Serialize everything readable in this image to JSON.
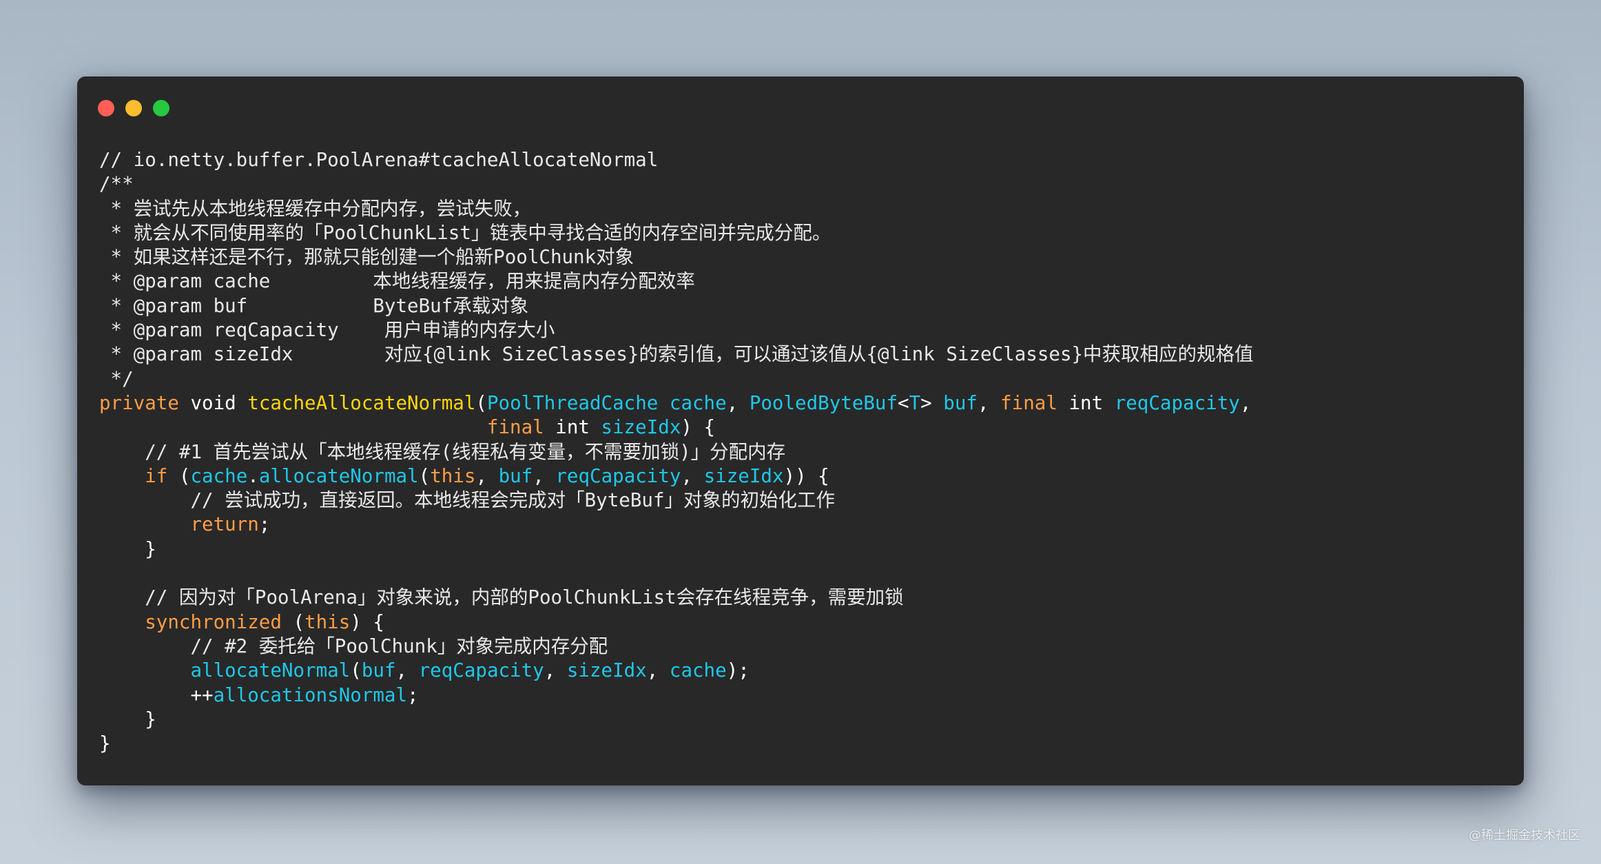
{
  "window": {
    "background": "#282828",
    "buttons": [
      {
        "name": "close",
        "color": "#ff5f57"
      },
      {
        "name": "minimize",
        "color": "#febc2e"
      },
      {
        "name": "maximize",
        "color": "#28c840"
      }
    ]
  },
  "syntax_colors": {
    "comment": "#e8e8e8",
    "keyword": "#ff9d45",
    "type": "#ffffff",
    "method": "#ffd60a",
    "identifier": "#1fc7e8",
    "plain": "#ffffff"
  },
  "code_lines": [
    [
      {
        "t": "// io.netty.buffer.PoolArena#tcacheAllocateNormal",
        "c": "comment"
      }
    ],
    [
      {
        "t": "/**",
        "c": "comment"
      }
    ],
    [
      {
        "t": " * 尝试先从本地线程缓存中分配内存，尝试失败，",
        "c": "comment"
      }
    ],
    [
      {
        "t": " * 就会从不同使用率的「PoolChunkList」链表中寻找合适的内存空间并完成分配。",
        "c": "comment"
      }
    ],
    [
      {
        "t": " * 如果这样还是不行，那就只能创建一个船新PoolChunk对象",
        "c": "comment"
      }
    ],
    [
      {
        "t": " * @param cache         本地线程缓存，用来提高内存分配效率",
        "c": "comment"
      }
    ],
    [
      {
        "t": " * @param buf           ByteBuf承载对象",
        "c": "comment"
      }
    ],
    [
      {
        "t": " * @param reqCapacity    用户申请的内存大小",
        "c": "comment"
      }
    ],
    [
      {
        "t": " * @param sizeIdx        对应{@link SizeClasses}的索引值，可以通过该值从{@link SizeClasses}中获取相应的规格值",
        "c": "comment"
      }
    ],
    [
      {
        "t": " */",
        "c": "comment"
      }
    ],
    [
      {
        "t": "private",
        "c": "keyword"
      },
      {
        "t": " ",
        "c": "plain"
      },
      {
        "t": "void",
        "c": "type"
      },
      {
        "t": " ",
        "c": "plain"
      },
      {
        "t": "tcacheAllocateNormal",
        "c": "method"
      },
      {
        "t": "(",
        "c": "plain"
      },
      {
        "t": "PoolThreadCache",
        "c": "identifier"
      },
      {
        "t": " ",
        "c": "plain"
      },
      {
        "t": "cache",
        "c": "identifier"
      },
      {
        "t": ", ",
        "c": "plain"
      },
      {
        "t": "PooledByteBuf",
        "c": "identifier"
      },
      {
        "t": "<",
        "c": "plain"
      },
      {
        "t": "T",
        "c": "identifier"
      },
      {
        "t": "> ",
        "c": "plain"
      },
      {
        "t": "buf",
        "c": "identifier"
      },
      {
        "t": ", ",
        "c": "plain"
      },
      {
        "t": "final",
        "c": "keyword"
      },
      {
        "t": " ",
        "c": "plain"
      },
      {
        "t": "int",
        "c": "type"
      },
      {
        "t": " ",
        "c": "plain"
      },
      {
        "t": "reqCapacity",
        "c": "identifier"
      },
      {
        "t": ",",
        "c": "plain"
      }
    ],
    [
      {
        "t": "                                  ",
        "c": "plain"
      },
      {
        "t": "final",
        "c": "keyword"
      },
      {
        "t": " ",
        "c": "plain"
      },
      {
        "t": "int",
        "c": "type"
      },
      {
        "t": " ",
        "c": "plain"
      },
      {
        "t": "sizeIdx",
        "c": "identifier"
      },
      {
        "t": ") {",
        "c": "plain"
      }
    ],
    [
      {
        "t": "    // #1 首先尝试从「本地线程缓存(线程私有变量，不需要加锁)」分配内存",
        "c": "comment"
      }
    ],
    [
      {
        "t": "    ",
        "c": "plain"
      },
      {
        "t": "if",
        "c": "keyword"
      },
      {
        "t": " (",
        "c": "plain"
      },
      {
        "t": "cache",
        "c": "identifier"
      },
      {
        "t": ".",
        "c": "plain"
      },
      {
        "t": "allocateNormal",
        "c": "identifier"
      },
      {
        "t": "(",
        "c": "plain"
      },
      {
        "t": "this",
        "c": "keyword"
      },
      {
        "t": ", ",
        "c": "plain"
      },
      {
        "t": "buf",
        "c": "identifier"
      },
      {
        "t": ", ",
        "c": "plain"
      },
      {
        "t": "reqCapacity",
        "c": "identifier"
      },
      {
        "t": ", ",
        "c": "plain"
      },
      {
        "t": "sizeIdx",
        "c": "identifier"
      },
      {
        "t": ")) {",
        "c": "plain"
      }
    ],
    [
      {
        "t": "        // 尝试成功，直接返回。本地线程会完成对「ByteBuf」对象的初始化工作",
        "c": "comment"
      }
    ],
    [
      {
        "t": "        ",
        "c": "plain"
      },
      {
        "t": "return",
        "c": "keyword"
      },
      {
        "t": ";",
        "c": "plain"
      }
    ],
    [
      {
        "t": "    }",
        "c": "plain"
      }
    ],
    [
      {
        "t": "",
        "c": "plain"
      }
    ],
    [
      {
        "t": "    // 因为对「PoolArena」对象来说，内部的PoolChunkList会存在线程竞争，需要加锁",
        "c": "comment"
      }
    ],
    [
      {
        "t": "    ",
        "c": "plain"
      },
      {
        "t": "synchronized",
        "c": "keyword"
      },
      {
        "t": " (",
        "c": "plain"
      },
      {
        "t": "this",
        "c": "keyword"
      },
      {
        "t": ") {",
        "c": "plain"
      }
    ],
    [
      {
        "t": "        // #2 委托给「PoolChunk」对象完成内存分配",
        "c": "comment"
      }
    ],
    [
      {
        "t": "        ",
        "c": "plain"
      },
      {
        "t": "allocateNormal",
        "c": "identifier"
      },
      {
        "t": "(",
        "c": "plain"
      },
      {
        "t": "buf",
        "c": "identifier"
      },
      {
        "t": ", ",
        "c": "plain"
      },
      {
        "t": "reqCapacity",
        "c": "identifier"
      },
      {
        "t": ", ",
        "c": "plain"
      },
      {
        "t": "sizeIdx",
        "c": "identifier"
      },
      {
        "t": ", ",
        "c": "plain"
      },
      {
        "t": "cache",
        "c": "identifier"
      },
      {
        "t": ");",
        "c": "plain"
      }
    ],
    [
      {
        "t": "        ++",
        "c": "plain"
      },
      {
        "t": "allocationsNormal",
        "c": "identifier"
      },
      {
        "t": ";",
        "c": "plain"
      }
    ],
    [
      {
        "t": "    }",
        "c": "plain"
      }
    ],
    [
      {
        "t": "}",
        "c": "plain"
      }
    ]
  ],
  "watermark": "@稀土掘金技术社区"
}
